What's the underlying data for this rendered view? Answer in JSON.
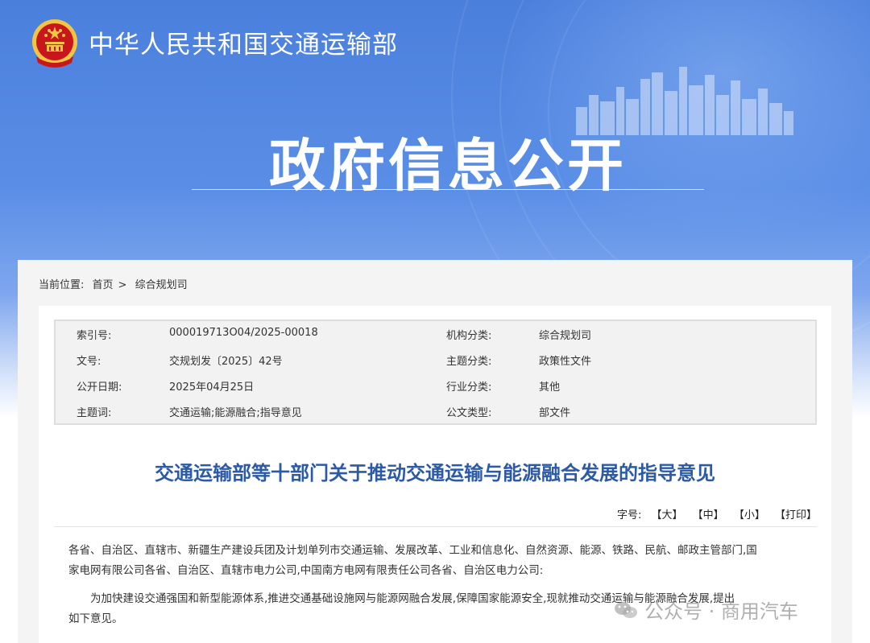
{
  "header": {
    "ministry_name": "中华人民共和国交通运输部",
    "page_heading": "政府信息公开"
  },
  "breadcrumb": {
    "prefix": "当前位置:",
    "home": "首页",
    "separator": ">",
    "current": "综合规划司"
  },
  "meta": {
    "index_label": "索引号:",
    "index_value": "000019713O04/2025-00018",
    "org_label": "机构分类:",
    "org_value": "综合规划司",
    "docno_label": "文号:",
    "docno_value": "交规划发〔2025〕42号",
    "topic_label": "主题分类:",
    "topic_value": "政策性文件",
    "date_label": "公开日期:",
    "date_value": "2025年04月25日",
    "industry_label": "行业分类:",
    "industry_value": "其他",
    "keywords_label": "主题词:",
    "keywords_value": "交通运输;能源融合;指导意见",
    "doctype_label": "公文类型:",
    "doctype_value": "部文件"
  },
  "document": {
    "title": "交通运输部等十部门关于推动交通运输与能源融合发展的指导意见",
    "fontsize_label": "字号:",
    "large": "【大】",
    "medium": "【中】",
    "small": "【小】",
    "print": "【打印】",
    "para1_line1": "各省、自治区、直辖市、新疆生产建设兵团及计划单列市交通运输、发展改革、工业和信息化、自然资源、能源、铁路、民航、邮政主管部门,国",
    "para1_line2": "家电网有限公司各省、自治区、直辖市电力公司,中国南方电网有限责任公司各省、自治区电力公司:",
    "para2_line1": "为加快建设交通强国和新型能源体系,推进交通基础设施网与能源网融合发展,保障国家能源安全,现就推动交通运输与能源融合发展,提出",
    "para2_line2": "如下意见。"
  },
  "watermark": {
    "text": "公众号 · 商用汽车"
  },
  "colors": {
    "banner_blue": "#4a7fdc",
    "title_blue": "#2c5aa5",
    "emblem_red": "#c8161d",
    "emblem_gold": "#f4c542"
  }
}
